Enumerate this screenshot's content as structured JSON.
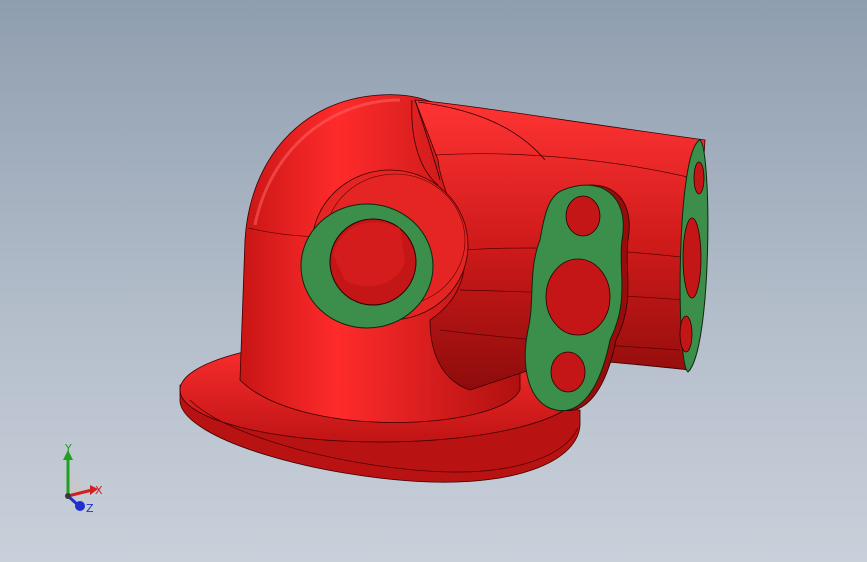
{
  "viewport": {
    "background_top": "#8f9eaf",
    "background_bottom": "#c9d0da",
    "model_color": "#e02020",
    "face_color": "#3c8f4a"
  },
  "model": {
    "name": "elbow-fitting-with-flanges",
    "parts": [
      "base-flange",
      "elbow-body",
      "round-port-face",
      "oval-flange-face",
      "branch-pipe",
      "end-flange-face"
    ]
  },
  "triad": {
    "x_label": "X",
    "y_label": "Y",
    "z_label": "Z",
    "x_color": "#d02020",
    "y_color": "#20a020",
    "z_color": "#2030d0"
  }
}
